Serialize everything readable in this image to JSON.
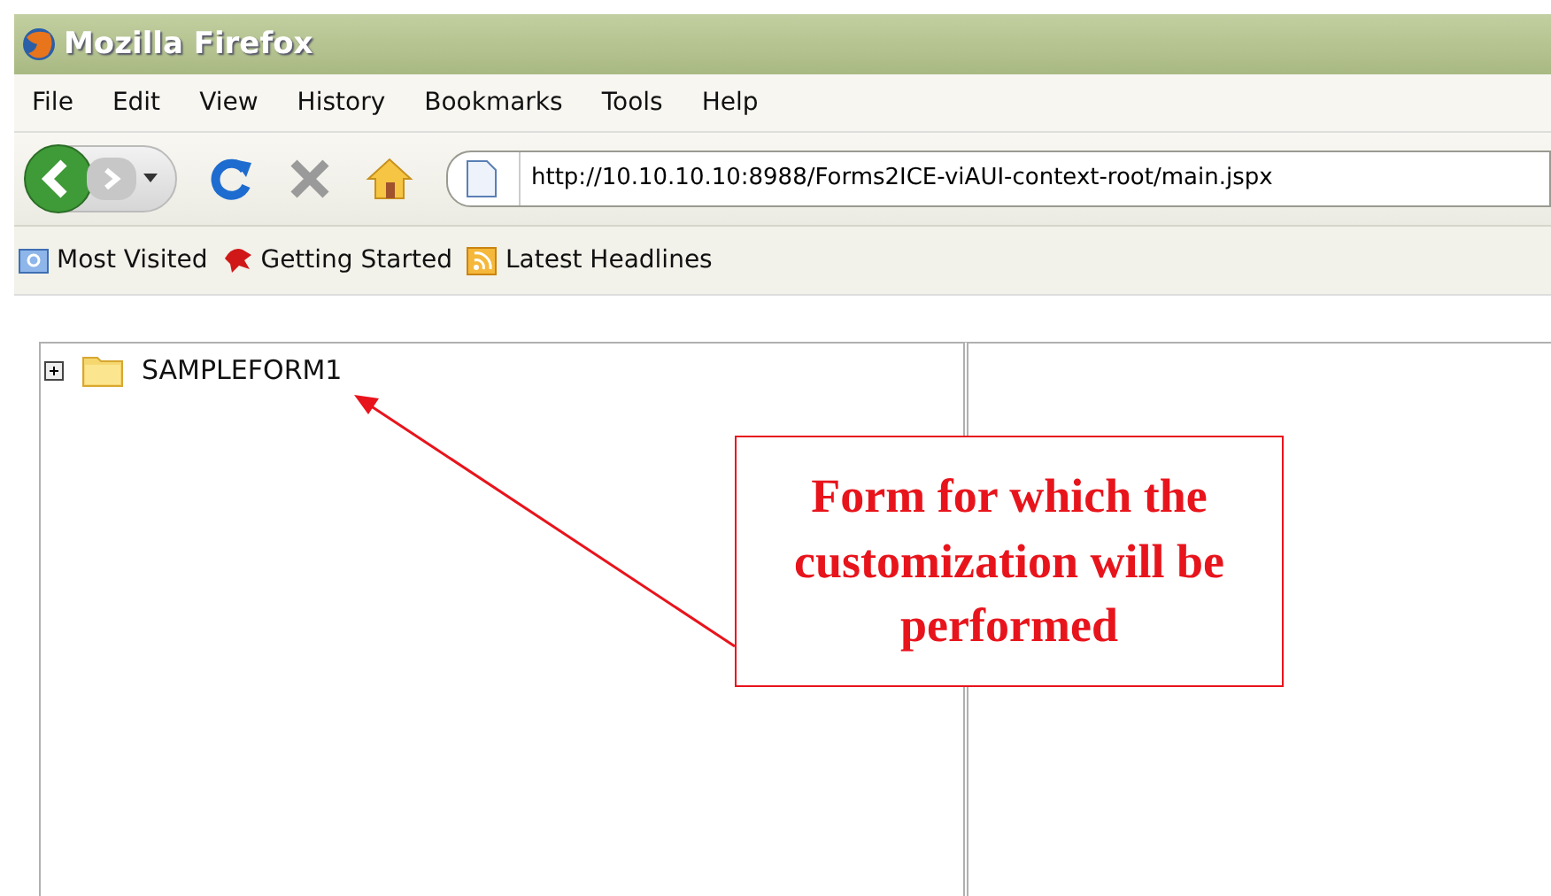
{
  "window": {
    "title": "Mozilla Firefox"
  },
  "menu": [
    "File",
    "Edit",
    "View",
    "History",
    "Bookmarks",
    "Tools",
    "Help"
  ],
  "address": {
    "value": "http://10.10.10.10:8988/Forms2ICE-viAUI-context-root/main.jspx"
  },
  "bookmarks": [
    {
      "label": "Most Visited",
      "kind": "folder"
    },
    {
      "label": "Getting Started",
      "kind": "page"
    },
    {
      "label": "Latest Headlines",
      "kind": "feed"
    }
  ],
  "tree": [
    {
      "label": "SAMPLEFORM1",
      "expanded": false
    }
  ],
  "callout": {
    "text": "Form for which the customization will be performed"
  }
}
